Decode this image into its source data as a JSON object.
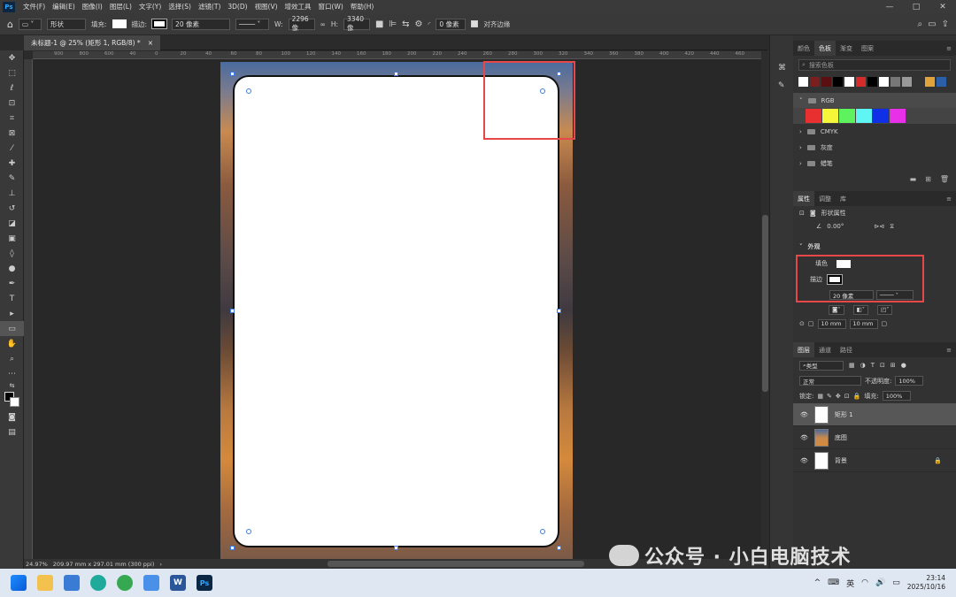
{
  "menu": {
    "app_icon": "Ps",
    "items": [
      "文件(F)",
      "编辑(E)",
      "图像(I)",
      "图层(L)",
      "文字(Y)",
      "选择(S)",
      "滤镜(T)",
      "3D(D)",
      "视图(V)",
      "增效工具",
      "窗口(W)",
      "帮助(H)"
    ],
    "window_controls": [
      "—",
      "□",
      "✕"
    ]
  },
  "options": {
    "mode": "形状",
    "fill_label": "填充:",
    "stroke_label": "描边:",
    "stroke_width": "20 像素",
    "w_label": "W:",
    "w_value": "2296 像",
    "h_label": "H:",
    "h_value": "3340 像",
    "radius": "0 像素",
    "align_edges": "对齐边缘"
  },
  "document": {
    "tab_title": "未标题-1 @ 25% (矩形 1, RGB/8) *",
    "close": "×"
  },
  "ruler": {
    "ticks": [
      "900",
      "800",
      "600",
      "40",
      "0",
      "20",
      "40",
      "60",
      "80",
      "100",
      "120",
      "140",
      "160",
      "180",
      "200",
      "220",
      "240",
      "260",
      "280",
      "300",
      "320",
      "340",
      "360",
      "380",
      "400",
      "420",
      "440",
      "460"
    ]
  },
  "status": {
    "zoom": "24.97%",
    "doc_info": "209.97 mm x 297.01 mm (300 ppi)",
    "arrow": "›"
  },
  "panels": {
    "swatches_tabs": [
      "颜色",
      "色板",
      "渐变",
      "图案"
    ],
    "swatch_search": "搜索色板",
    "recent_colors": [
      "#ffffff",
      "#7a1f1f",
      "#5a1010",
      "#000000",
      "#ffffff",
      "#d62b2b",
      "#000000",
      "#ffffff",
      "#777777",
      "#999999",
      "#333333",
      "#e0a23a",
      "#2b5fa8"
    ],
    "groups": [
      {
        "name": "RGB",
        "colors": [
          "#e83030",
          "#f5f53a",
          "#5ff25f",
          "#5ff5f5",
          "#1030e8",
          "#e830e8"
        ]
      },
      {
        "name": "CMYK"
      },
      {
        "name": "灰度"
      },
      {
        "name": "蜡笔"
      }
    ],
    "props_tabs": [
      "属性",
      "调整",
      "库"
    ],
    "props_title": "形状属性",
    "angle": "0.00°",
    "appearance": "外观",
    "fill_label": "填色",
    "stroke_label": "描边",
    "stroke_width": "20 像素",
    "corner_1": "10 mm",
    "corner_2": "10 mm",
    "layers_tabs": [
      "图层",
      "通道",
      "路径"
    ],
    "kind": "类型",
    "blend_mode": "正常",
    "opacity_label": "不透明度:",
    "opacity": "100%",
    "lock_label": "锁定:",
    "fill_pct_label": "填充:",
    "fill_pct": "100%",
    "layers": [
      {
        "name": "矩形 1",
        "active": true
      },
      {
        "name": "底图",
        "active": false
      },
      {
        "name": "背景",
        "active": false
      }
    ]
  },
  "watermark": "公众号 · 小白电脑技术",
  "taskbar": {
    "ime": "英",
    "time": "23:14",
    "date": "2025/10/16",
    "app_ps": "Ps",
    "app_word": "W"
  },
  "colors": {
    "accent_red": "#e8474a",
    "selection_blue": "#3d7be0",
    "ps_blue": "#31a8ff"
  }
}
